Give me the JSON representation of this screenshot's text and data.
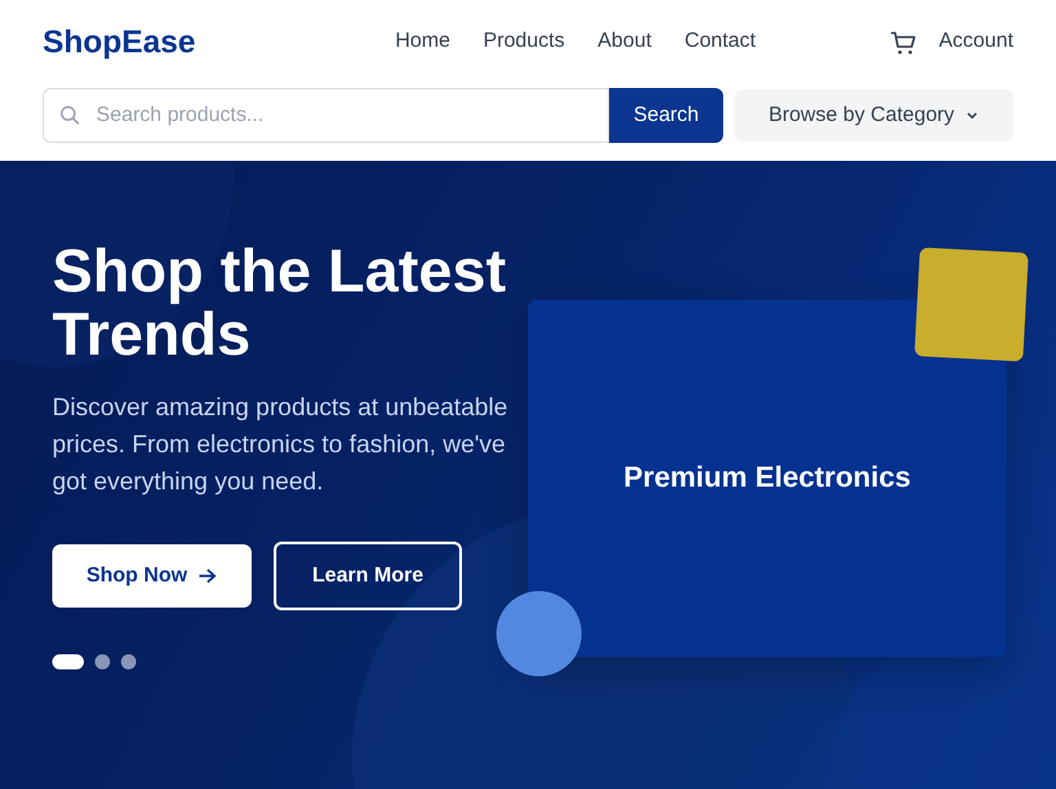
{
  "brand": "ShopEase",
  "nav": [
    {
      "label": "Home"
    },
    {
      "label": "Products"
    },
    {
      "label": "About"
    },
    {
      "label": "Contact"
    }
  ],
  "account": "Account",
  "search": {
    "placeholder": "Search products...",
    "button": "Search"
  },
  "category": "Browse by Category",
  "hero": {
    "title": "Shop the Latest Trends",
    "subtitle": "Discover amazing products at unbeatable prices. From electronics to fashion, we've got everything you need.",
    "primary": "Shop Now",
    "secondary": "Learn More",
    "card": "Premium Electronics",
    "dots": [
      {
        "selected": true
      },
      {
        "selected": false
      },
      {
        "selected": false
      }
    ]
  }
}
